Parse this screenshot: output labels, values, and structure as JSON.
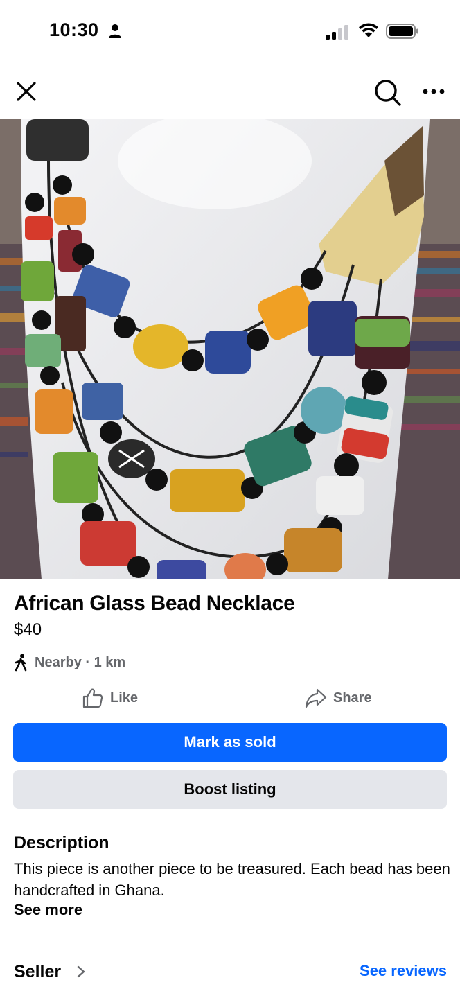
{
  "status_bar": {
    "time": "10:30",
    "icons": [
      "person-icon",
      "signal-icon",
      "wifi-icon",
      "battery-icon"
    ]
  },
  "nav": {
    "icons": [
      "close-icon",
      "search-icon",
      "more-icon"
    ]
  },
  "listing": {
    "title": "African Glass Bead Necklace",
    "price": "$40",
    "location": "Nearby · 1 km"
  },
  "actions": {
    "like_label": "Like",
    "share_label": "Share"
  },
  "buttons": {
    "mark_sold": "Mark as sold",
    "boost": "Boost listing"
  },
  "description": {
    "heading": "Description",
    "body": "This piece is another piece to be treasured.  Each bead has been handcrafted in Ghana.",
    "see_more": "See more"
  },
  "seller": {
    "label": "Seller",
    "see_reviews": "See reviews"
  },
  "colors": {
    "accent": "#0866ff",
    "secondary_button": "#e4e6eb",
    "muted_text": "#65676b"
  }
}
